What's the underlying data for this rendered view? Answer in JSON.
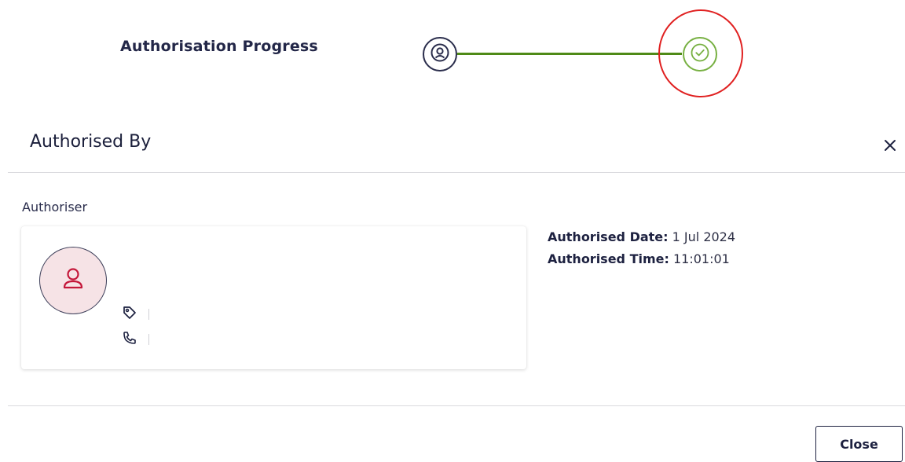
{
  "progress": {
    "title": "Authorisation Progress",
    "steps": [
      {
        "icon": "user-circle-icon",
        "status": "completed"
      },
      {
        "icon": "check-circle-icon",
        "status": "completed",
        "highlighted": true
      }
    ],
    "colors": {
      "line": "#4f8a17",
      "done": "#77b042",
      "highlight": "#e02020"
    }
  },
  "panel": {
    "title": "Authorised By",
    "close_icon": "close-icon",
    "authoriser_label": "Authoriser",
    "card": {
      "avatar_icon": "user-icon",
      "tag_icon": "tag-icon",
      "tag_value": "",
      "phone_icon": "phone-icon",
      "phone_value": ""
    },
    "date_label": "Authorised Date:",
    "date_value": "1 Jul 2024",
    "time_label": "Authorised Time:",
    "time_value": "11:01:01"
  },
  "footer": {
    "close_label": "Close"
  }
}
